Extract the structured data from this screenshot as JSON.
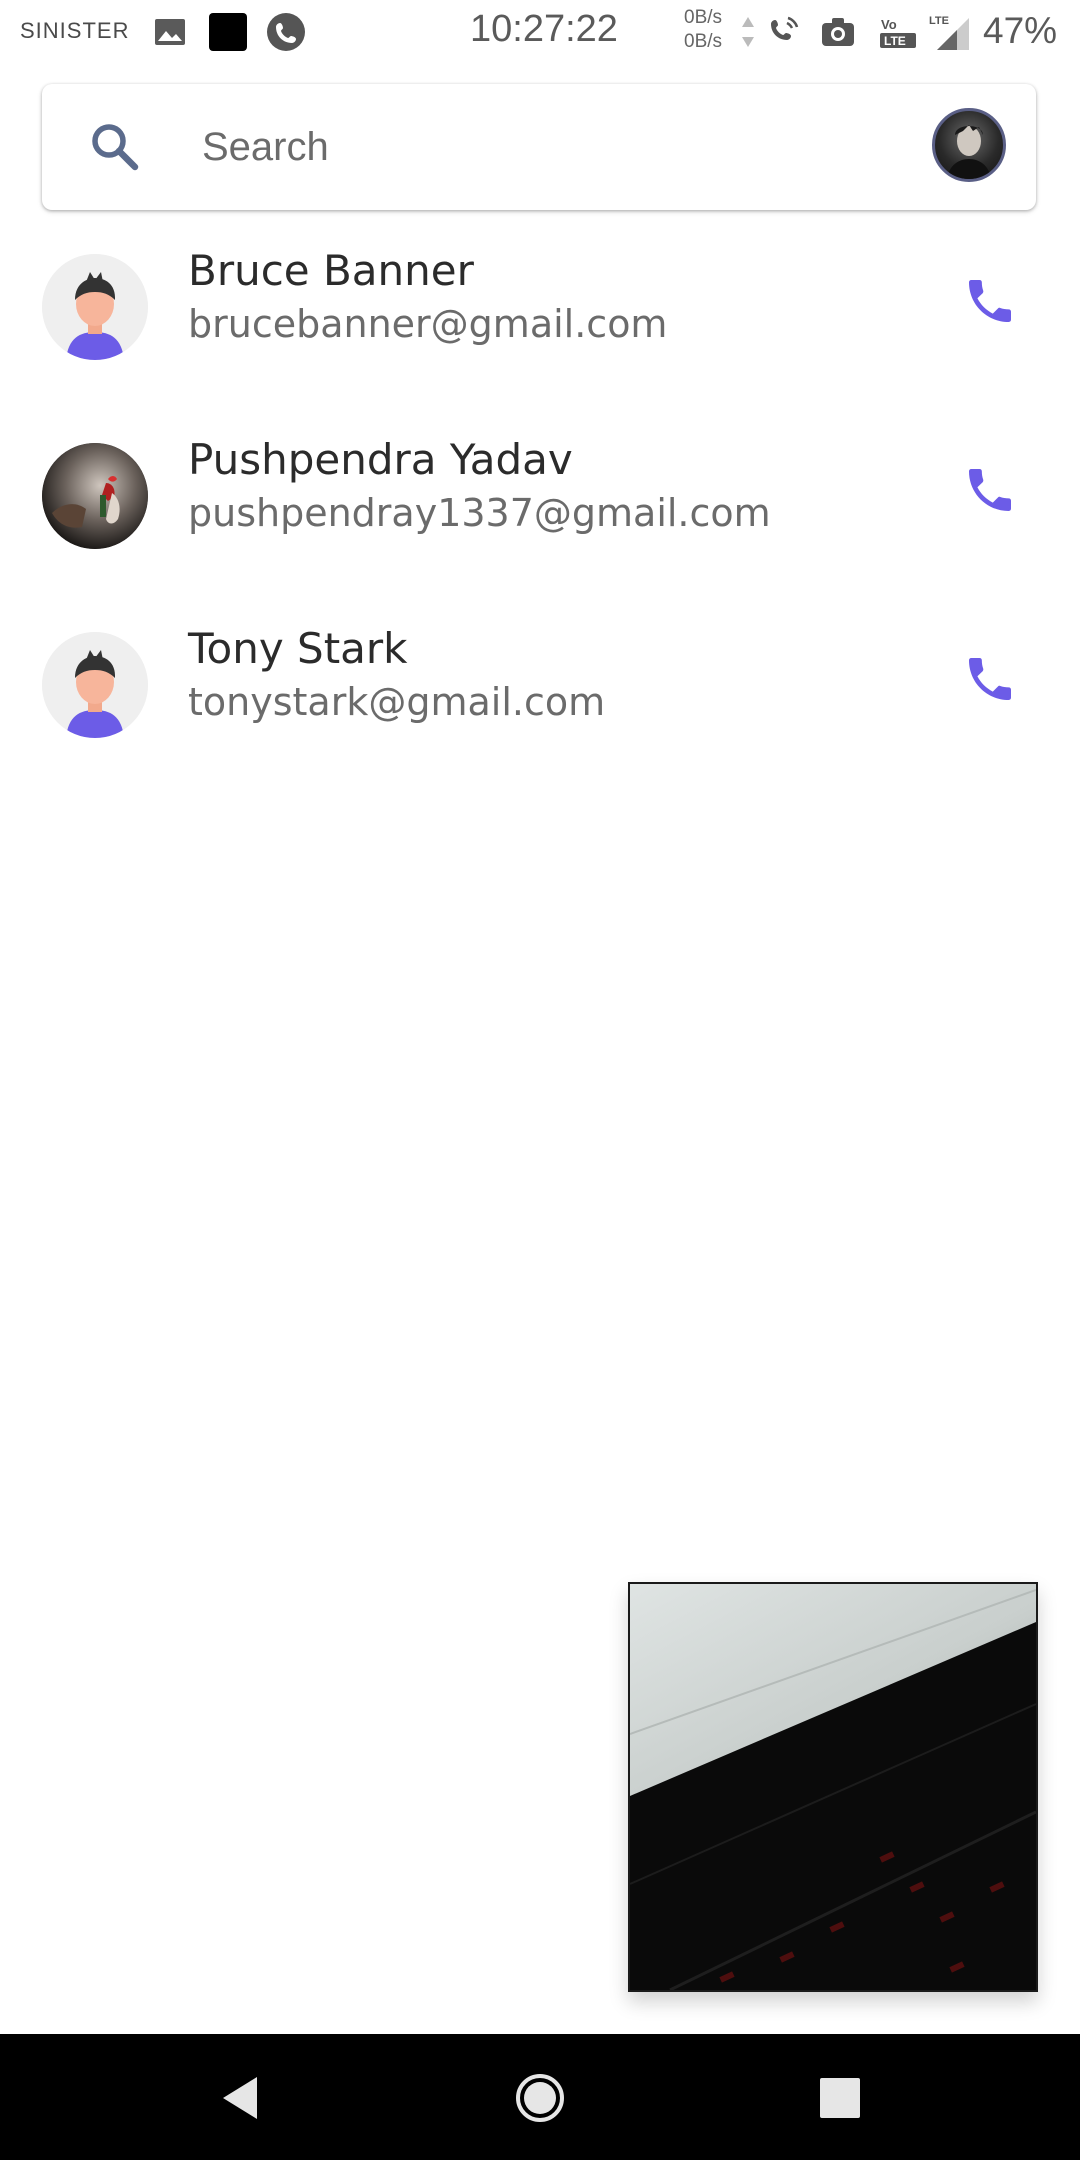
{
  "status_bar": {
    "carrier": "SINISTER",
    "time": "10:27:22",
    "net_up": "0B/s",
    "net_down": "0B/s",
    "battery": "47%"
  },
  "search": {
    "placeholder": "Search"
  },
  "contacts": [
    {
      "name": "Bruce Banner",
      "email": "brucebanner@gmail.com",
      "avatar": "default-avatar"
    },
    {
      "name": "Pushpendra Yadav",
      "email": "pushpendray1337@gmail.com",
      "avatar": "photo-avatar"
    },
    {
      "name": "Tony Stark",
      "email": "tonystark@gmail.com",
      "avatar": "default-avatar"
    }
  ],
  "colors": {
    "accent": "#6c5ce7",
    "search_icon": "#5b6b8c",
    "avatar_skin": "#f7b59b",
    "avatar_hair": "#333333",
    "avatar_shirt": "#6c5ce7"
  },
  "icons": {
    "search": "search-icon",
    "call": "phone-icon",
    "nav_back": "back-triangle-icon",
    "nav_home": "home-circle-icon",
    "nav_recents": "recents-square-icon"
  }
}
